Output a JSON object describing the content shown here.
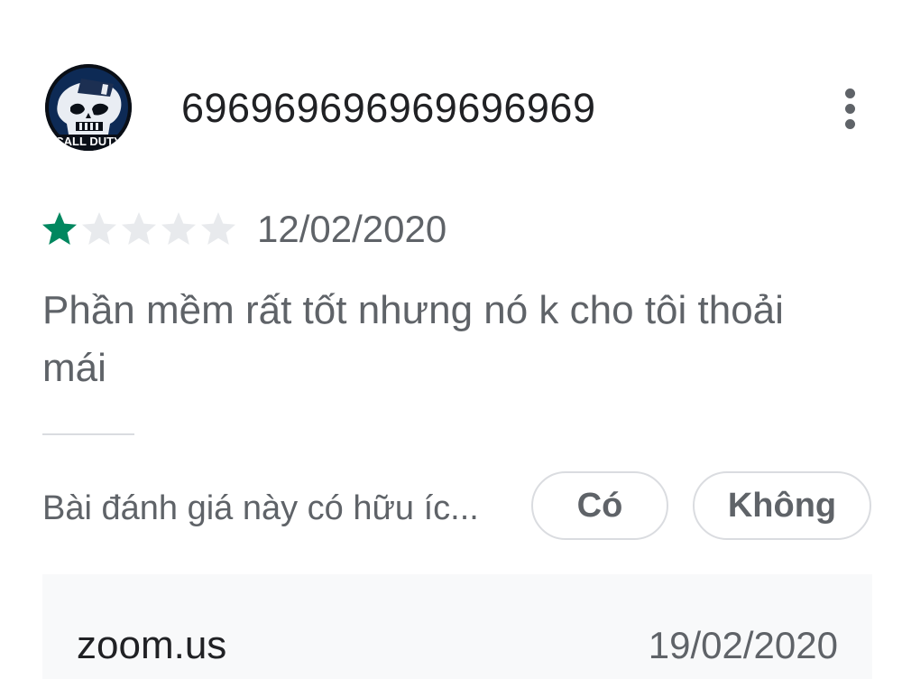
{
  "review": {
    "avatar_icon": "call-of-duty-skull-logo",
    "avatar_text": "CALL DUTY",
    "username": "696969696969696969",
    "more_icon": "more-vert-icon",
    "rating": 1,
    "rating_max": 5,
    "star_filled_color": "#01875f",
    "star_empty_color": "#e8eaed",
    "date": "12/02/2020",
    "text": "Phần mềm rất tốt nhưng nó k cho tôi thoải mái"
  },
  "helpful": {
    "question": "Bài đánh giá này có hữu íc...",
    "yes_label": "Có",
    "no_label": "Không"
  },
  "developer_reply": {
    "author": "zoom.us",
    "date": "19/02/2020"
  }
}
